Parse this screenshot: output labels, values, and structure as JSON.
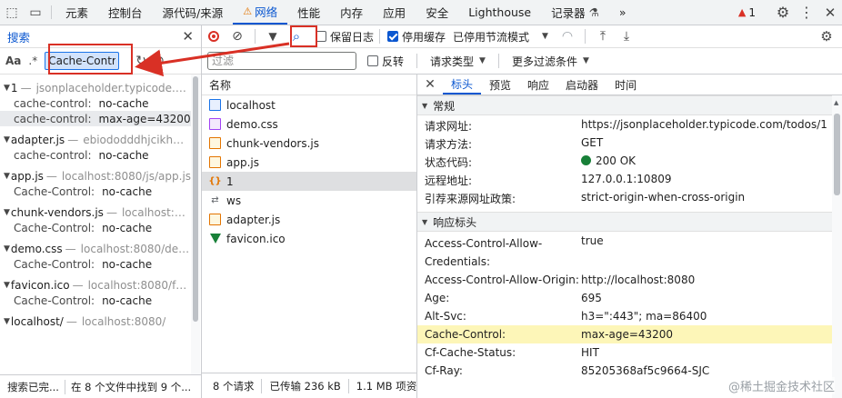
{
  "topbar": {
    "tabs": [
      "元素",
      "控制台",
      "源代码/来源",
      "网络",
      "性能",
      "内存",
      "应用",
      "安全",
      "Lighthouse",
      "记录器"
    ],
    "active_tab": "网络",
    "more": "»",
    "warning_count": "1"
  },
  "search_panel": {
    "title": "搜索",
    "match_case": "Aa",
    "regex": ".*",
    "query": "Cache-Control",
    "results": [
      {
        "file": "1",
        "url": "jsonplaceholder.typicode.co...",
        "lines": [
          {
            "k": "cache-control:",
            "v": "no-cache"
          },
          {
            "k": "cache-control:",
            "v": "max-age=43200"
          }
        ]
      },
      {
        "file": "adapter.js",
        "url": "ebiododddhjcikhmi...",
        "lines": [
          {
            "k": "cache-control:",
            "v": "no-cache"
          }
        ]
      },
      {
        "file": "app.js",
        "url": "localhost:8080/js/app.js",
        "lines": [
          {
            "k": "Cache-Control:",
            "v": "no-cache"
          }
        ]
      },
      {
        "file": "chunk-vendors.js",
        "url": "localhost:808...",
        "lines": [
          {
            "k": "Cache-Control:",
            "v": "no-cache"
          }
        ]
      },
      {
        "file": "demo.css",
        "url": "localhost:8080/demo...",
        "lines": [
          {
            "k": "Cache-Control:",
            "v": "no-cache"
          }
        ]
      },
      {
        "file": "favicon.ico",
        "url": "localhost:8080/favic...",
        "lines": [
          {
            "k": "Cache-Control:",
            "v": "no-cache"
          }
        ]
      },
      {
        "file": "localhost/",
        "url": "localhost:8080/",
        "lines": []
      }
    ],
    "status_left": "搜索已完...",
    "status_right": "在 8 个文件中找到 9 个..."
  },
  "network_toolbar": {
    "preserve_log": "保留日志",
    "disable_cache": "停用缓存",
    "throttling": "已停用节流模式"
  },
  "filter_bar": {
    "placeholder": "过滤",
    "invert": "反转",
    "request_types": "请求类型",
    "more_filters": "更多过滤条件"
  },
  "request_list": {
    "header": "名称",
    "rows": [
      {
        "name": "localhost",
        "icon": "doc"
      },
      {
        "name": "demo.css",
        "icon": "css"
      },
      {
        "name": "chunk-vendors.js",
        "icon": "js"
      },
      {
        "name": "app.js",
        "icon": "js"
      },
      {
        "name": "1",
        "icon": "json"
      },
      {
        "name": "ws",
        "icon": "ws"
      },
      {
        "name": "adapter.js",
        "icon": "js"
      },
      {
        "name": "favicon.ico",
        "icon": "ico"
      }
    ],
    "footer_requests": "8 个请求",
    "footer_transferred": "已传输 236 kB",
    "footer_resources": "1.1 MB 项资"
  },
  "details": {
    "tabs": [
      "标头",
      "预览",
      "响应",
      "启动器",
      "时间"
    ],
    "active_tab": "标头",
    "general_title": "常规",
    "general": [
      {
        "k": "请求网址:",
        "v": "https://jsonplaceholder.typicode.com/todos/1"
      },
      {
        "k": "请求方法:",
        "v": "GET"
      },
      {
        "k": "状态代码:",
        "v": "200 OK"
      },
      {
        "k": "远程地址:",
        "v": "127.0.0.1:10809"
      },
      {
        "k": "引荐来源网址政策:",
        "v": "strict-origin-when-cross-origin"
      }
    ],
    "response_title": "响应标头",
    "response": [
      {
        "k": "Access-Control-Allow-Credentials:",
        "v": "true"
      },
      {
        "k": "Access-Control-Allow-Origin:",
        "v": "http://localhost:8080"
      },
      {
        "k": "Age:",
        "v": "695"
      },
      {
        "k": "Alt-Svc:",
        "v": "h3=\":443\"; ma=86400"
      },
      {
        "k": "Cache-Control:",
        "v": "max-age=43200"
      },
      {
        "k": "Cf-Cache-Status:",
        "v": "HIT"
      },
      {
        "k": "Cf-Ray:",
        "v": "85205368af5c9664-SJC"
      }
    ]
  },
  "watermark": "@稀土掘金技术社区",
  "colors": {
    "accent": "#0b57d0",
    "highlight": "#d93025",
    "row_highlight": "#fdf6b8"
  }
}
